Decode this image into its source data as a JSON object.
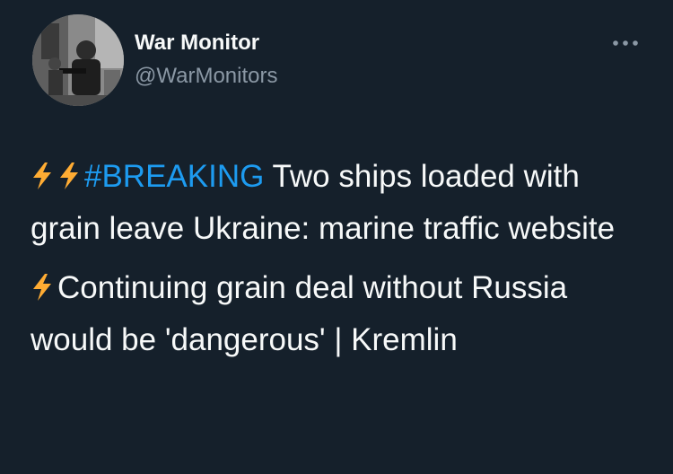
{
  "tweet": {
    "author": {
      "display_name": "War Monitor",
      "handle": "@WarMonitors"
    },
    "more_icon": "ellipsis-icon",
    "colors": {
      "background": "#15202b",
      "text": "#f7f9f9",
      "secondary": "#8b98a5",
      "link": "#1d9bf0",
      "bolt": "#ffac33"
    },
    "paragraph1": {
      "hashtag": "#BREAKING",
      "text": " Two ships loaded with grain leave Ukraine: marine traffic website"
    },
    "paragraph2": {
      "text": "Continuing grain deal without Russia would be 'dangerous' | Kremlin"
    }
  }
}
